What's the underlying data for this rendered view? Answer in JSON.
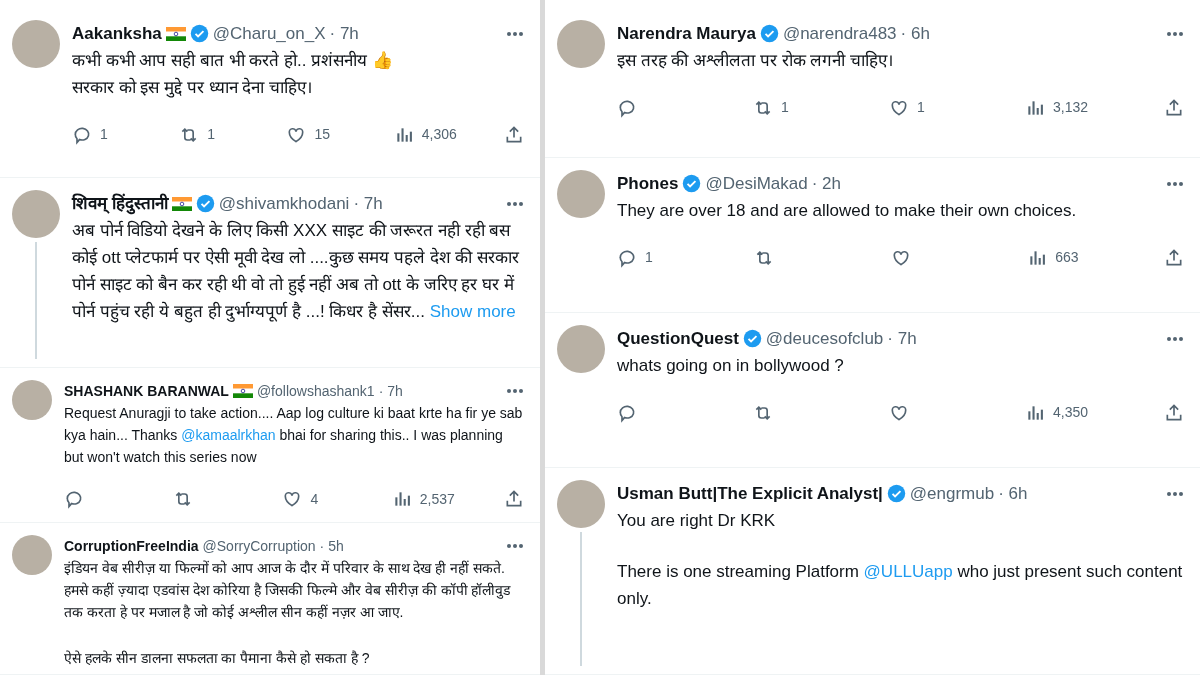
{
  "columns": [
    {
      "tweets": [
        {
          "name": "Aakanksha",
          "flag": true,
          "verified": true,
          "handle": "@Charu_on_X",
          "time": "· 7h",
          "thread_line": false,
          "body": [
            [
              {
                "kind": "line",
                "text": "कभी कभी आप सही बात भी करते हो.. प्रशंसनीय 👍"
              },
              {
                "kind": "line",
                "text": "सरकार को इस मुद्दे पर ध्यान देना चाहिए।"
              }
            ]
          ],
          "actions": {
            "reply": "1",
            "retweet": "1",
            "like": "15",
            "views": "4,306"
          }
        },
        {
          "name": "शिवम् हिंदुस्तानी",
          "flag": true,
          "verified": true,
          "handle": "@shivamkhodani",
          "time": "· 7h",
          "thread_line": true,
          "body": [
            [
              {
                "kind": "text",
                "text": "अब पोर्न विडियो देखने के लिए किसी  XXX साइट की जरूरत नही रही बस कोई ott प्लेटफार्म  पर ऐसी मूवी देख लो ....कुछ समय पहले  देश की सरकार पोर्न साइट को बैन कर रही थी  वो तो हुई नहीं अब तो ott के जरिए हर घर में पोर्न  पहुंच रही ये  बहुत ही दुर्भाग्यपूर्ण है ...! किधर है सेंसर... "
              },
              {
                "kind": "link",
                "text": "Show more"
              }
            ]
          ]
        },
        {
          "name": "SHASHANK BARANWAL",
          "flag": true,
          "verified": false,
          "handle": "@followshashank1",
          "time": "· 7h",
          "thread_line": false,
          "body": [
            [
              {
                "kind": "text",
                "text": "Request Anuragji to take action.... Aap log culture ki baat krte ha fir ye sab kya hain... Thanks "
              },
              {
                "kind": "link",
                "text": "@kamaalrkhan"
              },
              {
                "kind": "text",
                "text": " bhai for sharing this.. I was planning but won't watch this series now"
              }
            ]
          ],
          "actions": {
            "like": "4",
            "views": "2,537"
          }
        },
        {
          "name": "CorruptionFreeIndia",
          "flag": false,
          "verified": false,
          "handle": "@SorryCorruption",
          "time": "· 5h",
          "thread_line": false,
          "body": [
            [
              {
                "kind": "text",
                "text": "इंडियन वेब सीरीज़ या फिल्मों को आप आज के दौर में परिवार के साथ देख ही नहीं सकते. हमसे कहीं ज़्यादा एडवांस देश कोरिया है जिसकी फिल्मे और वेब सीरीज़ की कॉपी हॉलीवुड तक करता हे पर मजाल है जो कोई अश्लील सीन कहीं नज़र आ जाए."
              }
            ],
            [
              {
                "kind": "text",
                "text": "ऐसे हलके सीन डालना सफलता का पैमाना कैसे हो सकता है ?"
              }
            ]
          ]
        }
      ]
    },
    {
      "tweets": [
        {
          "name": "Narendra Maurya",
          "flag": false,
          "verified": true,
          "handle": "@narendra483",
          "time": "· 6h",
          "thread_line": false,
          "body": [
            [
              {
                "kind": "text",
                "text": "इस तरह की अश्लीलता पर रोक लगनी चाहिए।"
              }
            ]
          ],
          "actions": {
            "retweet": "1",
            "like": "1",
            "views": "3,132"
          }
        },
        {
          "name": "Phones",
          "flag": false,
          "verified": true,
          "handle": "@DesiMakad",
          "time": "· 2h",
          "thread_line": false,
          "body": [
            [
              {
                "kind": "text",
                "text": "They are over 18 and are allowed to make their own choices."
              }
            ]
          ],
          "actions": {
            "reply": "1",
            "views": "663"
          }
        },
        {
          "name": "QuestionQuest",
          "flag": false,
          "verified": true,
          "handle": "@deucesofclub",
          "time": "· 7h",
          "thread_line": false,
          "body": [
            [
              {
                "kind": "text",
                "text": "whats going on in  bollywood ?"
              }
            ]
          ],
          "actions": {
            "views": "4,350"
          }
        },
        {
          "name": "Usman Butt|The Explicit Analyst|",
          "flag": false,
          "verified": true,
          "handle": "@engrmub",
          "time": "· 6h",
          "thread_line": true,
          "body": [
            [
              {
                "kind": "text",
                "text": "You are right Dr KRK"
              }
            ],
            [
              {
                "kind": "text",
                "text": "There is one streaming Platform "
              },
              {
                "kind": "link",
                "text": "@ULLUapp"
              },
              {
                "kind": "text",
                "text": " who just present such content only."
              }
            ]
          ]
        }
      ]
    }
  ]
}
